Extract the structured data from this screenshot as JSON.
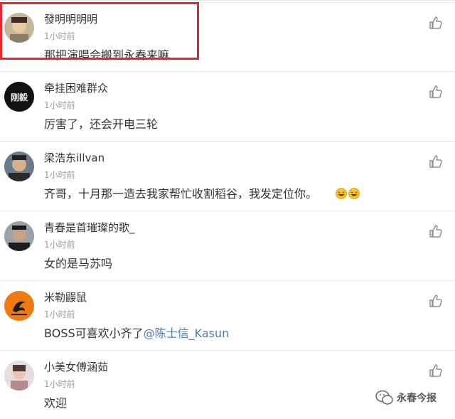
{
  "comments": [
    {
      "user": "發明明明明",
      "time": "1小时前",
      "text": "那把演唱会搬到永春来嘛",
      "avatar_icon": "user-photo-avatar"
    },
    {
      "user": "牵挂困难群众",
      "time": "1小时前",
      "text": "厉害了，还会开电三轮",
      "avatar_icon": "calligraphy-avatar"
    },
    {
      "user": "梁浩东illvan",
      "time": "1小时前",
      "text": "齐哥，十月那一造去我家帮忙收割稻谷，我发定位你。",
      "avatar_icon": "user-photo-avatar"
    },
    {
      "user": "青春是首璀璨的歌_",
      "time": "1小时前",
      "text": "女的是马苏吗",
      "avatar_icon": "user-photo-avatar"
    },
    {
      "user": "米勒鼹鼠",
      "time": "1小时前",
      "text": "BOSS可喜欢小齐了",
      "mention": "@陈士信_Kasun",
      "avatar_icon": "mole-logo-avatar"
    },
    {
      "user": "小美女傅涵茹",
      "time": "1小时前",
      "text": "欢迎",
      "avatar_icon": "user-photo-avatar"
    }
  ],
  "watermark": {
    "label": "永春今报"
  },
  "colors": {
    "highlight": "#e8262f",
    "mention": "#507daf",
    "time": "#9a9a9a"
  }
}
